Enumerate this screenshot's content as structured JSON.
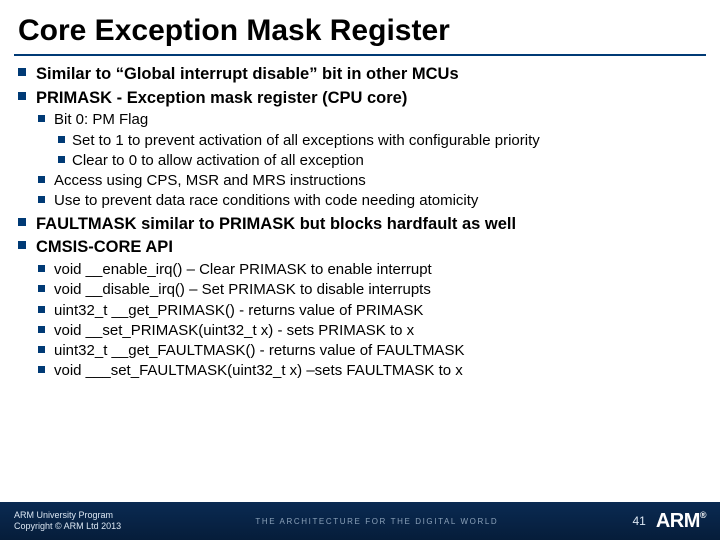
{
  "title": "Core Exception Mask Register",
  "bullets": {
    "b1": "Similar to “Global interrupt disable” bit in other MCUs",
    "b2": "PRIMASK - Exception mask register (CPU core)",
    "b2a": "Bit 0: PM Flag",
    "b2a1": "Set to 1 to prevent activation of all exceptions with configurable priority",
    "b2a2": "Clear to 0 to allow activation of all exception",
    "b2b": "Access using CPS, MSR and MRS instructions",
    "b2c": "Use to prevent data race conditions with code needing atomicity",
    "b3": "FAULTMASK  similar to PRIMASK but blocks hardfault as well",
    "b4": "CMSIS-CORE API",
    "b4a": "void __enable_irq() – Clear PRIMASK to enable interrupt",
    "b4b": "void __disable_irq() – Set PRIMASK to disable interrupts",
    "b4c": "uint32_t __get_PRIMASK() - returns value of PRIMASK",
    "b4d": "void __set_PRIMASK(uint32_t x) - sets PRIMASK to x",
    "b4e": "uint32_t __get_FAULTMASK() - returns value of FAULTMASK",
    "b4f": "void ___set_FAULTMASK(uint32_t x) –sets FAULTMASK to x"
  },
  "footer": {
    "program": "ARM University Program",
    "copyright": "Copyright © ARM Ltd 2013",
    "tagline": "THE ARCHITECTURE FOR THE DIGITAL WORLD",
    "page": "41",
    "logo": "ARM"
  }
}
